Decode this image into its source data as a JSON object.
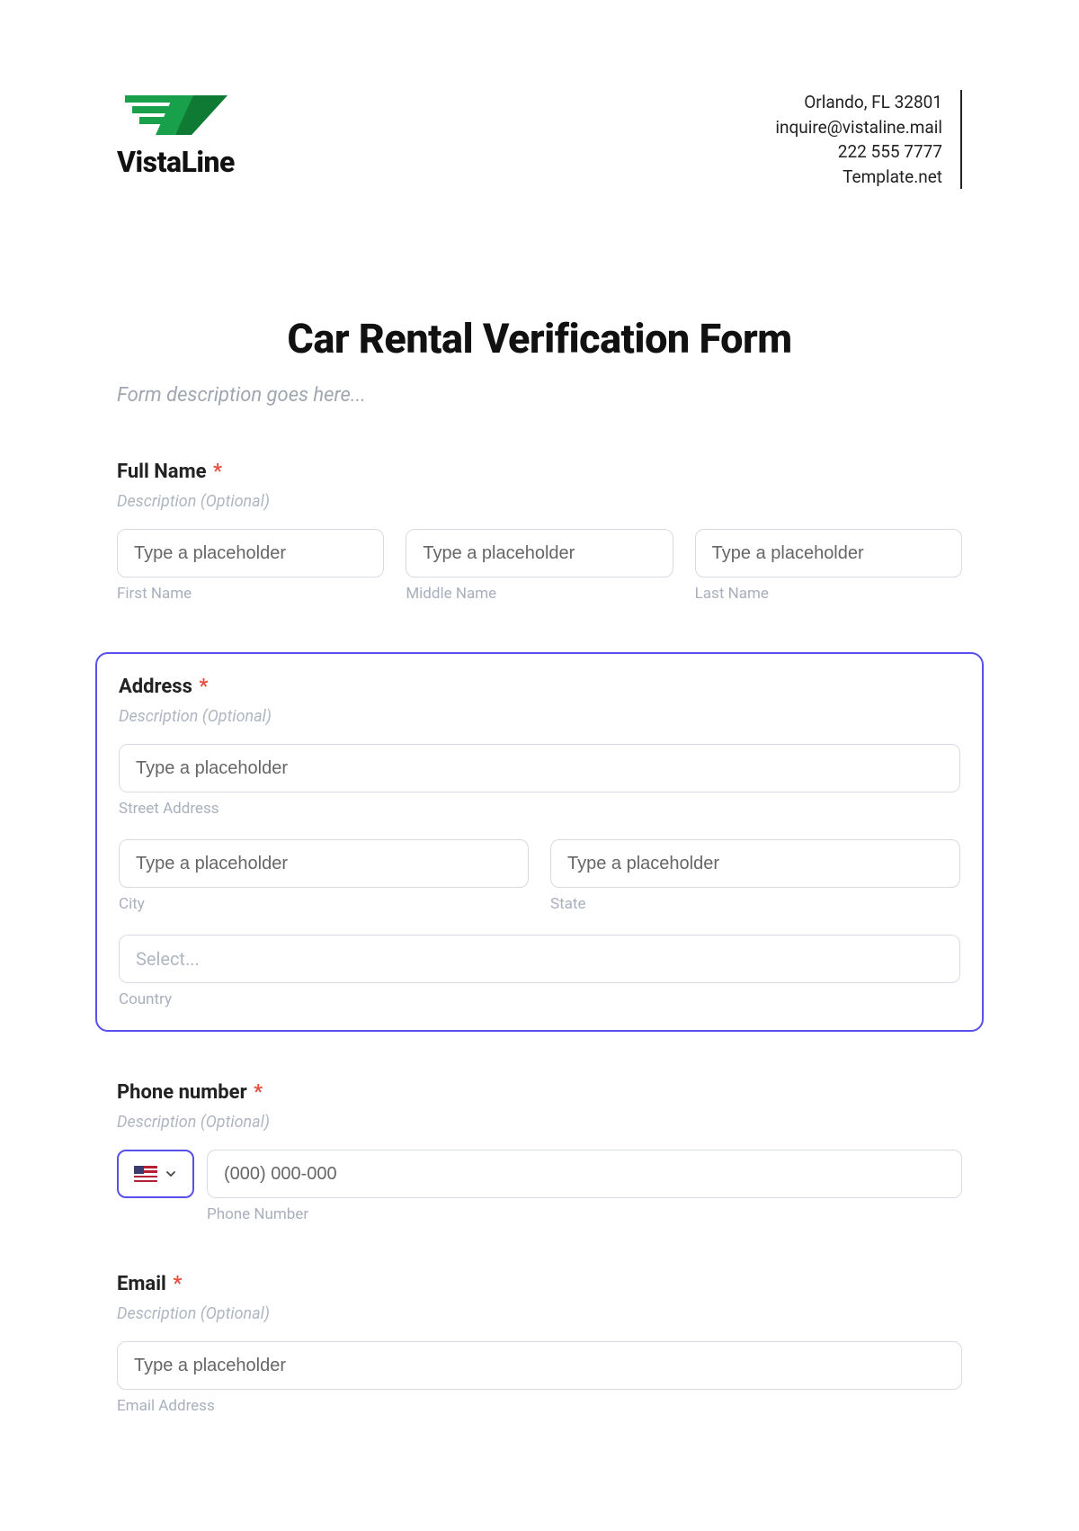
{
  "header": {
    "brand_name": "VistaLine",
    "address_line": "Orlando, FL 32801",
    "email_line": "inquire@vistaline.mail",
    "phone_line": "222 555 7777",
    "site_line": "Template.net"
  },
  "form": {
    "title": "Car Rental Verification Form",
    "description": "Form description goes here..."
  },
  "fullname": {
    "label": "Full Name",
    "required_mark": "*",
    "description": "Description (Optional)",
    "first_placeholder": "Type a placeholder",
    "first_sublabel": "First Name",
    "middle_placeholder": "Type a placeholder",
    "middle_sublabel": "Middle Name",
    "last_placeholder": "Type a placeholder",
    "last_sublabel": "Last Name"
  },
  "address": {
    "label": "Address",
    "required_mark": "*",
    "description": "Description (Optional)",
    "street_placeholder": "Type a placeholder",
    "street_sublabel": "Street Address",
    "city_placeholder": "Type a placeholder",
    "city_sublabel": "City",
    "state_placeholder": "Type a placeholder",
    "state_sublabel": "State",
    "country_placeholder": "Select...",
    "country_sublabel": "Country"
  },
  "phone": {
    "label": "Phone number",
    "required_mark": "*",
    "description": "Description (Optional)",
    "placeholder": "(000) 000-000",
    "sublabel": "Phone Number"
  },
  "email": {
    "label": "Email",
    "required_mark": "*",
    "description": "Description (Optional)",
    "placeholder": "Type a placeholder",
    "sublabel": "Email Address"
  }
}
